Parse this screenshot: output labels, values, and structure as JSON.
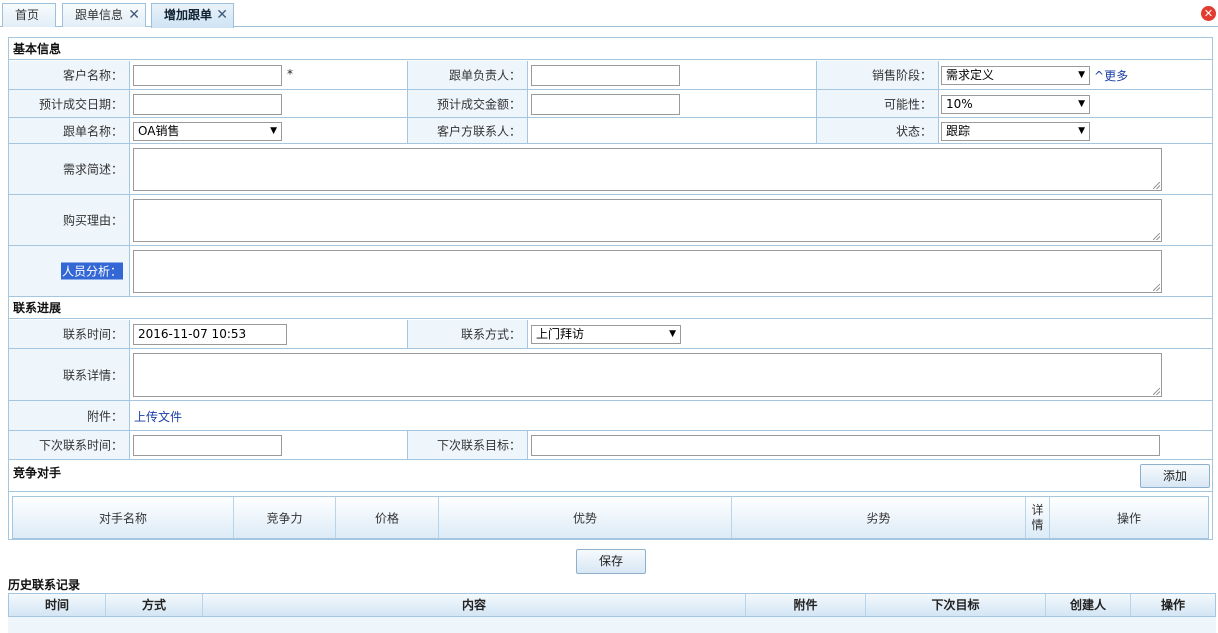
{
  "tabs": [
    {
      "label": "首页",
      "closable": false
    },
    {
      "label": "跟单信息",
      "closable": true
    },
    {
      "label": "增加跟单",
      "closable": true,
      "active": true
    }
  ],
  "tab_close_glyph": "✕",
  "close_all_glyph": "✕",
  "basic": {
    "title": "基本信息",
    "customer_name_label": "客户名称：",
    "customer_name_value": "",
    "required_mark": "*",
    "owner_label": "跟单负责人：",
    "owner_value": "",
    "stage_label": "销售阶段：",
    "stage_value": "需求定义",
    "more_link": "更多",
    "expected_date_label": "预计成交日期：",
    "expected_date_value": "",
    "expected_amount_label": "预计成交金额：",
    "expected_amount_value": "",
    "possibility_label": "可能性：",
    "possibility_value": "10%",
    "deal_name_label": "跟单名称：",
    "deal_name_value": "OA销售",
    "contact_label": "客户方联系人：",
    "status_label": "状态：",
    "status_value": "跟踪",
    "needs_label": "需求简述：",
    "reason_label": "购买理由：",
    "people_label": "人员分析："
  },
  "contact": {
    "title": "联系进展",
    "time_label": "联系时间：",
    "time_value": "2016-11-07 10:53",
    "method_label": "联系方式：",
    "method_value": "上门拜访",
    "detail_label": "联系详情：",
    "attachment_label": "附件：",
    "upload_link": "上传文件",
    "next_time_label": "下次联系时间：",
    "next_time_value": "",
    "next_goal_label": "下次联系目标：",
    "next_goal_value": ""
  },
  "competitors": {
    "title": "竞争对手",
    "add_button": "添加",
    "columns": [
      "对手名称",
      "竞争力",
      "价格",
      "优势",
      "劣势",
      "详情",
      "操作"
    ]
  },
  "save_button": "保存",
  "history": {
    "title": "历史联系记录",
    "columns": [
      "时间",
      "方式",
      "内容",
      "附件",
      "下次目标",
      "创建人",
      "操作"
    ]
  },
  "dropdown_arrow": "▼",
  "more_icon": "^"
}
